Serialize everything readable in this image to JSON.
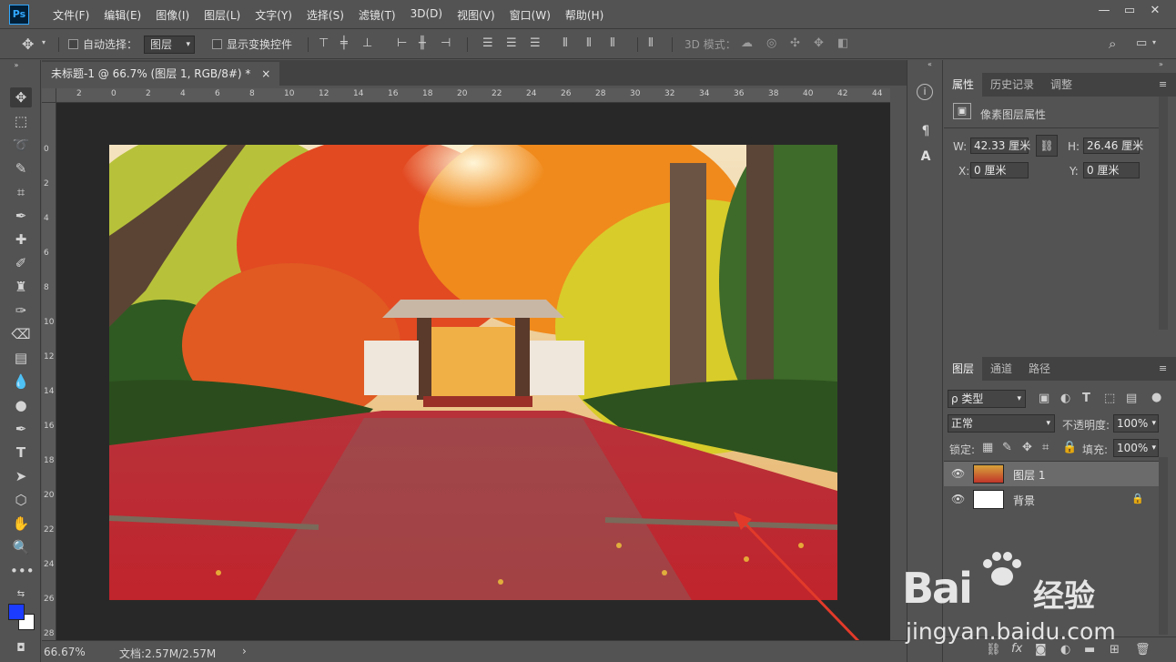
{
  "app": {
    "logo": "Ps",
    "accent_color": "#31a8ff"
  },
  "menu": [
    "文件(F)",
    "编辑(E)",
    "图像(I)",
    "图层(L)",
    "文字(Y)",
    "选择(S)",
    "滤镜(T)",
    "3D(D)",
    "视图(V)",
    "窗口(W)",
    "帮助(H)"
  ],
  "window_controls": {
    "minimize": "—",
    "restore": "▭",
    "close": "✕"
  },
  "options": {
    "auto_select_label": "自动选择：",
    "auto_select_target": "图层",
    "show_transform_label": "显示变换控件",
    "mode_3d_label": "3D 模式："
  },
  "document": {
    "tab_title": "未标题-1 @ 66.7% (图层 1, RGB/8#) *",
    "close": "×",
    "zoom": "66.67%",
    "doc_size": "文档:2.57M/2.57M",
    "status_arrow": "›"
  },
  "ruler_top": [
    "2",
    "0",
    "2",
    "4",
    "6",
    "8",
    "10",
    "12",
    "14",
    "16",
    "18",
    "20",
    "22",
    "24",
    "26",
    "28",
    "30",
    "32",
    "34",
    "36",
    "38",
    "40",
    "42",
    "44"
  ],
  "ruler_left": [
    "0",
    "2",
    "4",
    "6",
    "8",
    "10",
    "12",
    "14",
    "16",
    "18",
    "20",
    "22",
    "24",
    "26",
    "28"
  ],
  "properties_panel": {
    "tabs": [
      "属性",
      "历史记录",
      "调整"
    ],
    "header": "像素图层属性",
    "w_label": "W:",
    "w_value": "42.33 厘米",
    "h_label": "H:",
    "h_value": "26.46 厘米",
    "x_label": "X:",
    "x_value": "0 厘米",
    "y_label": "Y:",
    "y_value": "0 厘米"
  },
  "layers_panel": {
    "tabs": [
      "图层",
      "通道",
      "路径"
    ],
    "filter_kind": "ρ 类型",
    "blend_mode": "正常",
    "opacity_label": "不透明度:",
    "opacity_value": "100%",
    "lock_label": "锁定:",
    "fill_label": "填充:",
    "fill_value": "100%",
    "layers": [
      {
        "name": "图层 1",
        "selected": true
      },
      {
        "name": "背景",
        "selected": false
      }
    ]
  },
  "watermark": {
    "brand": "Bai",
    "brand_suffix": "经验",
    "url": "jingyan.baidu.com"
  },
  "colors": {
    "foreground": "#1c3cff",
    "background": "#ffffff"
  }
}
